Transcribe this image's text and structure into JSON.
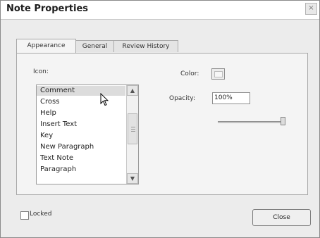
{
  "window": {
    "title": "Note Properties",
    "close_glyph": "×"
  },
  "tabs": [
    {
      "label": "Appearance",
      "active": true
    },
    {
      "label": "General",
      "active": false
    },
    {
      "label": "Review History",
      "active": false
    }
  ],
  "appearance": {
    "icon_label": "Icon:",
    "icon_options": [
      "Comment",
      "Cross",
      "Help",
      "Insert Text",
      "Key",
      "New Paragraph",
      "Text Note",
      "Paragraph"
    ],
    "selected_icon": "Comment",
    "color_label": "Color:",
    "color_value": "#f7f7f7",
    "opacity_label": "Opacity:",
    "opacity_value": "100%",
    "opacity_fraction": 1.0
  },
  "footer": {
    "locked_label": "Locked",
    "locked_checked": false,
    "close_label": "Close"
  },
  "icons": {
    "scroll_up": "scroll-up-icon",
    "scroll_down": "scroll-down-icon",
    "cursor": "mouse-cursor-icon"
  }
}
